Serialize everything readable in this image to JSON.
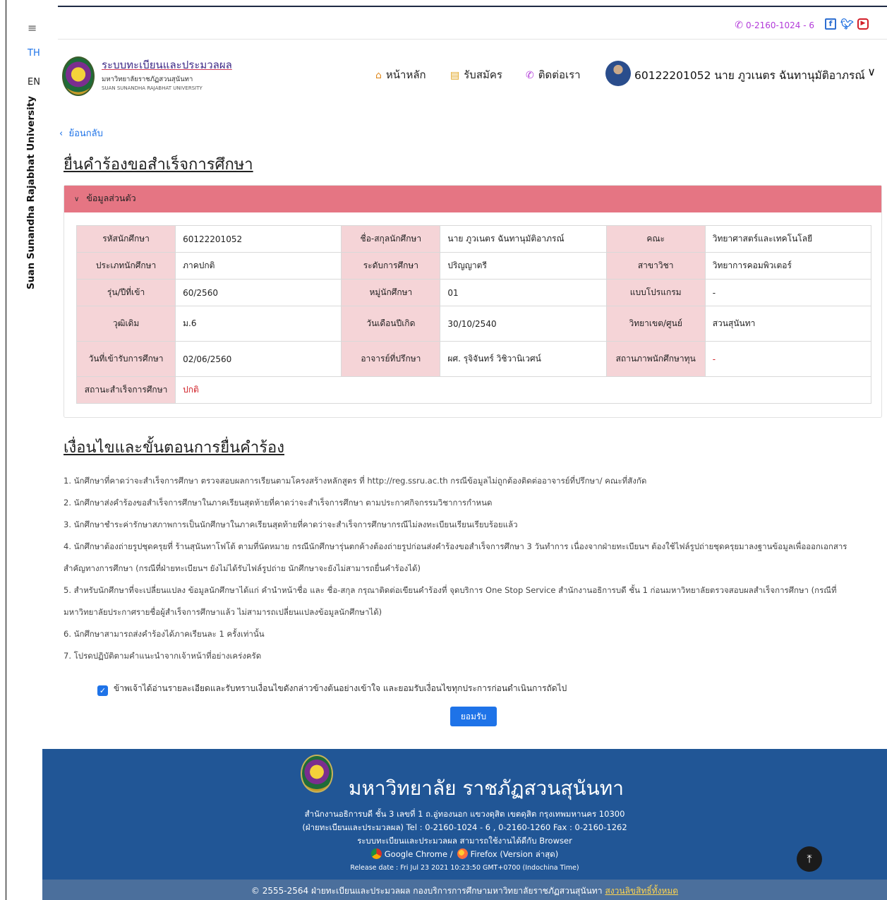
{
  "sidebar": {
    "menu_icon": "≡",
    "lang_th": "TH",
    "lang_en": "EN",
    "vertical_text": "Suan Sunandha Rajabhat University"
  },
  "topbar": {
    "phone": "0-2160-1024 - 6",
    "social": [
      "facebook-icon",
      "twitter-icon",
      "youtube-icon"
    ]
  },
  "header": {
    "brand_title": "ระบบทะเบียนและประมวลผล",
    "brand_sub_th": "มหาวิทยาลัยราชภัฏสวนสุนันทา",
    "brand_sub_en": "SUAN SUNANDHA RAJABHAT UNIVERSITY",
    "nav": {
      "home": "หน้าหลัก",
      "apply": "รับสมัคร",
      "contact": "ติดต่อเรา"
    },
    "user": "60122201052 นาย ภูวเนตร ฉันทานุมัติอาภรณ์"
  },
  "page": {
    "back": "ย้อนกลับ",
    "title": "ยื่นคำร้องขอสำเร็จการศึกษา",
    "panel_title": "ข้อมูลส่วนตัว",
    "conditions_title": "เงื่อนไขและขั้นตอนการยื่นคำร้อง"
  },
  "info": {
    "r1": {
      "l1": "รหัสนักศึกษา",
      "v1": "60122201052",
      "l2": "ชื่อ-สกุลนักศึกษา",
      "v2": "นาย ภูวเนตร ฉันทานุมัติอาภรณ์",
      "l3": "คณะ",
      "v3": "วิทยาศาสตร์และเทคโนโลยี"
    },
    "r2": {
      "l1": "ประเภทนักศึกษา",
      "v1": "ภาคปกติ",
      "l2": "ระดับการศึกษา",
      "v2": "ปริญญาตรี",
      "l3": "สาขาวิชา",
      "v3": "วิทยาการคอมพิวเตอร์"
    },
    "r3": {
      "l1": "รุ่น/ปีที่เข้า",
      "v1": "60/2560",
      "l2": "หมู่นักศึกษา",
      "v2": "01",
      "l3": "แบบโปรแกรม",
      "v3": "-"
    },
    "r4": {
      "l1": "วุฒิเดิม",
      "v1": "ม.6",
      "l2": "วันเดือนปีเกิด",
      "v2": "30/10/2540",
      "l3": "วิทยาเขต/ศูนย์",
      "v3": "สวนสุนันทา"
    },
    "r5": {
      "l1": "วันที่เข้ารับการศึกษา",
      "v1": "02/06/2560",
      "l2": "อาจารย์ที่ปรึกษา",
      "v2": "ผศ. รุจิจันทร์ วิชิวานิเวศน์",
      "l3": "สถานภาพนักศึกษาทุน",
      "v3": "-"
    },
    "r6": {
      "l1": "สถานะสำเร็จการศึกษา",
      "v1": "ปกติ"
    }
  },
  "conditions": [
    "1. นักศึกษาที่คาดว่าจะสำเร็จการศึกษา ตรวจสอบผลการเรียนตามโครงสร้างหลักสูตร ที่ http://reg.ssru.ac.th กรณีข้อมูลไม่ถูกต้องติดต่ออาจารย์ที่ปรึกษา/ คณะที่สังกัด",
    "2. นักศึกษาส่งคำร้องขอสำเร็จการศึกษาในภาคเรียนสุดท้ายที่คาดว่าจะสำเร็จการศึกษา ตามประกาศกิจกรรมวิชาการกำหนด",
    "3. นักศึกษาชำระค่ารักษาสภาพการเป็นนักศึกษาในภาคเรียนสุดท้ายที่คาดว่าจะสำเร็จการศึกษากรณีไม่ลงทะเบียนเรียนเรียบร้อยแล้ว",
    "4. นักศึกษาต้องถ่ายรูปชุดครุยที่ ร้านสุนันทาโฟโต้ ตามที่นัดหมาย กรณีนักศึกษารุ่นตกค้างต้องถ่ายรูปก่อนส่งคำร้องขอสำเร็จการศึกษา 3 วันทำการ เนื่องจากฝ่ายทะเบียนฯ ต้องใช้ไฟล์รูปถ่ายชุดครุยมาลงฐานข้อมูลเพื่อออกเอกสาร",
    "สำคัญทางการศึกษา (กรณีที่ฝ่ายทะเบียนฯ ยังไม่ได้รับไฟล์รูปถ่าย นักศึกษาจะยังไม่สามารถยื่นคำร้องได้)",
    "5. สำหรับนักศึกษาที่จะเปลี่ยนแปลง ข้อมูลนักศึกษาได้แก่ คำนำหน้าชื่อ และ ชื่อ-สกุล กรุณาติดต่อเขียนคำร้องที่ จุดบริการ One Stop Service สำนักงานอธิการบดี ชั้น 1 ก่อนมหาวิทยาลัยตรวจสอบผลสำเร็จการศึกษา (กรณีที่",
    "มหาวิทยาลัยประกาศรายชื่อผู้สำเร็จการศึกษาแล้ว ไม่สามารถเปลี่ยนแปลงข้อมูลนักศึกษาได้)",
    "6. นักศึกษาสามารถส่งคำร้องได้ภาคเรียนละ 1 ครั้งเท่านั้น",
    "7. โปรดปฏิบัติตามคำแนะนำจากเจ้าหน้าที่อย่างเคร่งครัด"
  ],
  "agreement": {
    "checked": true,
    "text": "ข้าพเจ้าได้อ่านรายละเอียดและรับทราบเงื่อนไขดังกล่าวข้างต้นอย่างเข้าใจ และยอมรับเงื่อนไขทุกประการก่อนดำเนินการถัดไป",
    "button": "ยอมรับ"
  },
  "footer": {
    "name": "มหาวิทยาลัย ราชภัฏสวนสุนันทา",
    "address": "สำนักงานอธิการบดี ชั้น 3 เลขที่ 1 ถ.อู่ทองนอก แขวงดุสิต เขตดุสิต กรุงเทพมหานคร 10300",
    "contact": "(ฝ่ายทะเบียนและประมวลผล) Tel : 0-2160-1024 - 6 , 0-2160-1260   Fax : 0-2160-1262",
    "browser_note": "ระบบทะเบียนและประมวลผล สามารถใช้งานได้ดีกับ Browser",
    "chrome": "Google Chrome /",
    "firefox": "Firefox (Version ล่าสุด)",
    "release": "Release date : Fri Jul 23 2021 10:23:50 GMT+0700 (Indochina Time)",
    "copyright": "© 2555-2564 ฝ่ายทะเบียนและประมวลผล กองบริการการศึกษามหาวิทยาลัยราชภัฏสวนสุนันทา",
    "copyright_link": "สงวนลิขสิทธิ์ทั้งหมด",
    "to_top": "⤒"
  }
}
